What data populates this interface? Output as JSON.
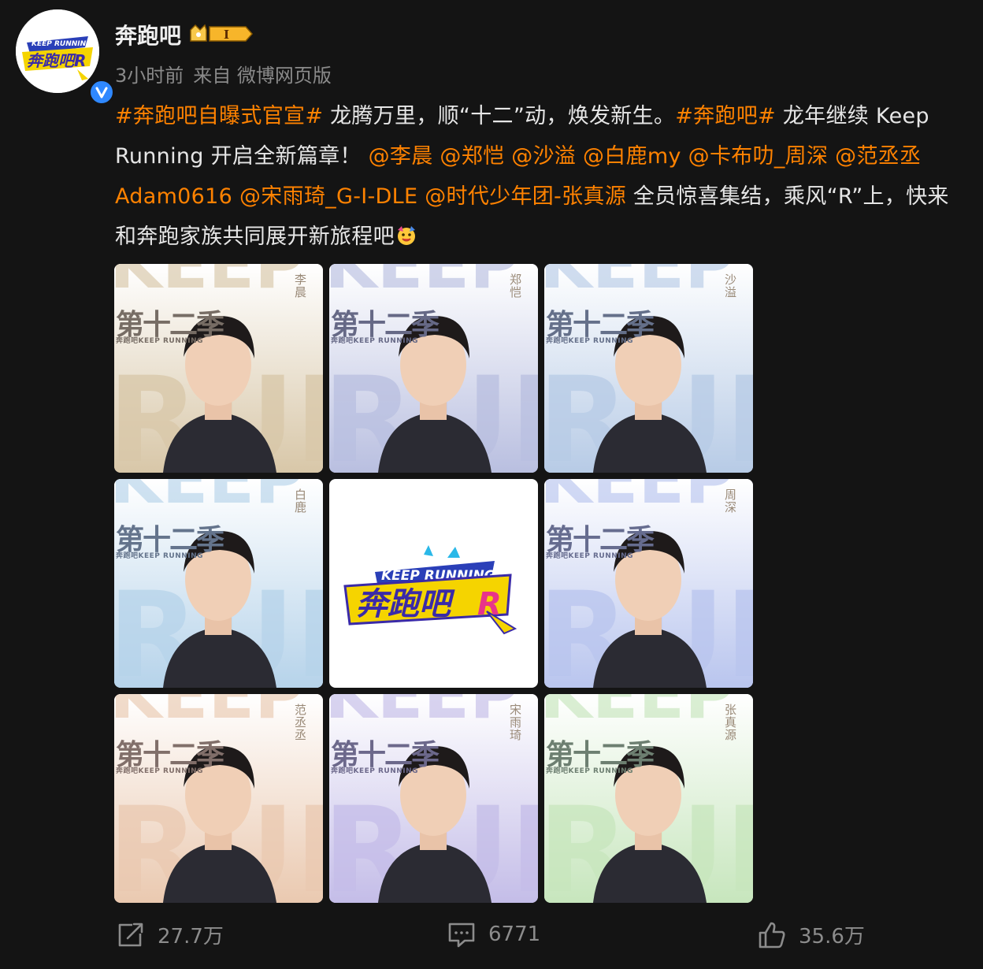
{
  "header": {
    "name": "奔跑吧",
    "vip_level": "I",
    "time": "3小时前",
    "source": "来自 微博网页版"
  },
  "post": {
    "tag1": "#奔跑吧自曝式官宣#",
    "text1": " 龙腾万里，顺“十二”动，焕发新生。",
    "tag2": "#奔跑吧#",
    "text2": " 龙年继续 Keep Running 开启全新篇章！",
    "mentions": [
      "@李晨",
      "@郑恺",
      "@沙溢",
      "@白鹿my",
      "@卡布叻_周深",
      "@范丞丞Adam0616",
      "@宋雨琦_G-I-DLE",
      "@时代少年团-张真源"
    ],
    "text3": " 全员惊喜集结，乘风“R”上，快来和奔跑家族共同展开新旅程吧",
    "emoji": "cheer-emoji"
  },
  "images": [
    {
      "name": "李晨",
      "tint": "#d8c7a8",
      "season": "第十二季",
      "sub": "奔跑吧KEEP RUNNING"
    },
    {
      "name": "郑恺",
      "tint": "#b9bfe0",
      "season": "第十二季",
      "sub": "奔跑吧KEEP RUNNING"
    },
    {
      "name": "沙溢",
      "tint": "#b7cbe6",
      "season": "第十二季",
      "sub": "奔跑吧KEEP RUNNING"
    },
    {
      "name": "白鹿",
      "tint": "#b6d3ea",
      "season": "第十二季",
      "sub": "奔跑吧KEEP RUNNING"
    },
    {
      "name": "",
      "tint": "#ffffff",
      "season": "",
      "sub": ""
    },
    {
      "name": "周深",
      "tint": "#b9c5ee",
      "season": "第十二季",
      "sub": "奔跑吧KEEP RUNNING"
    },
    {
      "name": "范丞丞",
      "tint": "#eac9b0",
      "season": "第十二季",
      "sub": "奔跑吧KEEP RUNNING"
    },
    {
      "name": "宋雨琦",
      "tint": "#c4bde8",
      "season": "第十二季",
      "sub": "奔跑吧KEEP RUNNING"
    },
    {
      "name": "张真源",
      "tint": "#c7e6bd",
      "season": "第十二季",
      "sub": "奔跑吧KEEP RUNNING"
    }
  ],
  "logo": {
    "line1": "KEEP RUNNING",
    "line2": "奔跑吧"
  },
  "actions": {
    "repost": "27.7万",
    "comment": "6771",
    "like": "35.6万"
  },
  "colors": {
    "accent": "#ff8200",
    "verified": "#2f88ff",
    "background": "#141414"
  }
}
